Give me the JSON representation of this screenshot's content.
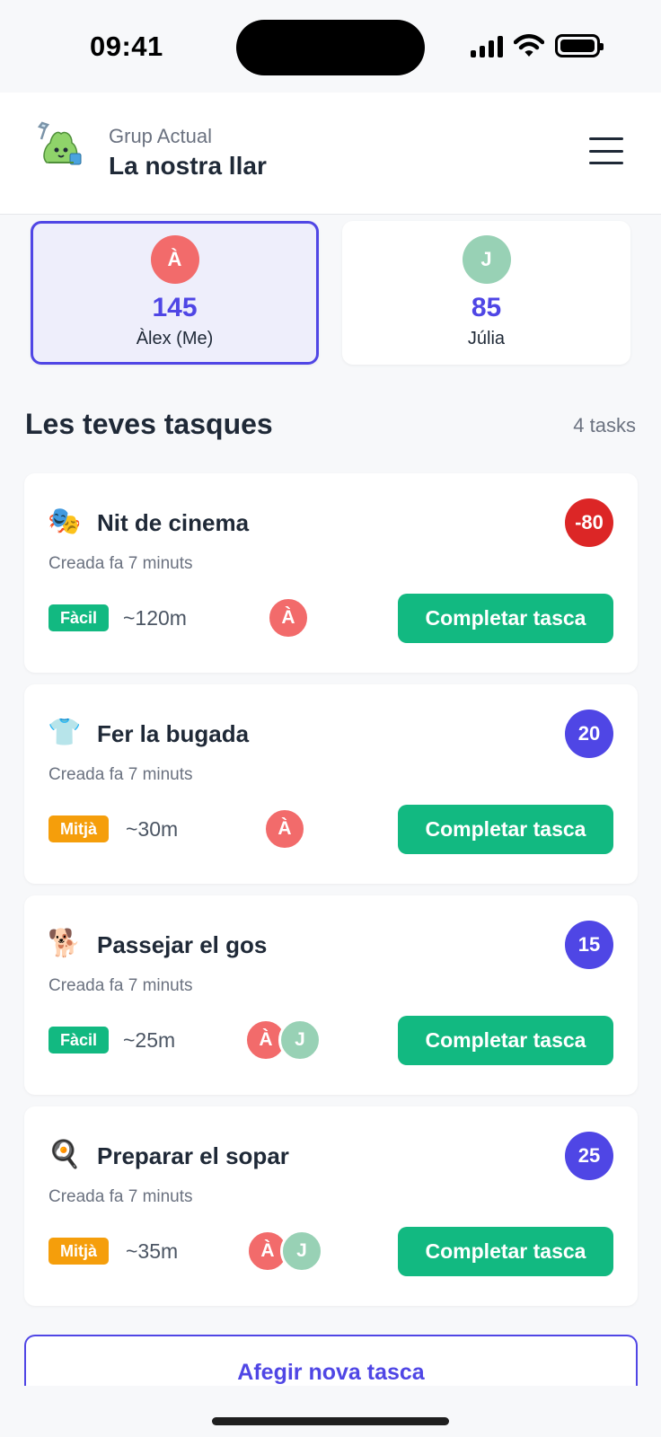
{
  "status_bar": {
    "time": "09:41"
  },
  "header": {
    "caption": "Grup Actual",
    "group_name": "La nostra llar"
  },
  "members": [
    {
      "initial": "À",
      "points": "145",
      "name": "Àlex (Me)",
      "color": "#f26b6b",
      "active": true
    },
    {
      "initial": "J",
      "points": "85",
      "name": "Júlia",
      "color": "#98d1b5",
      "active": false
    }
  ],
  "section": {
    "title": "Les teves tasques",
    "count": "4 tasks"
  },
  "tasks": [
    {
      "emoji": "🎭",
      "title": "Nit de cinema",
      "created": "Creada fa 7 minuts",
      "points": "-80",
      "points_color": "#dc2626",
      "difficulty": "Fàcil",
      "difficulty_color": "#12b981",
      "duration": "~120m",
      "assignees": [
        "À"
      ],
      "button": "Completar tasca"
    },
    {
      "emoji": "👕",
      "title": "Fer la bugada",
      "created": "Creada fa 7 minuts",
      "points": "20",
      "points_color": "#4f46e5",
      "difficulty": "Mitjà",
      "difficulty_color": "#f59e0b",
      "duration": "~30m",
      "assignees": [
        "À"
      ],
      "button": "Completar tasca"
    },
    {
      "emoji": "🐕",
      "title": "Passejar el gos",
      "created": "Creada fa 7 minuts",
      "points": "15",
      "points_color": "#4f46e5",
      "difficulty": "Fàcil",
      "difficulty_color": "#12b981",
      "duration": "~25m",
      "assignees": [
        "À",
        "J"
      ],
      "button": "Completar tasca"
    },
    {
      "emoji": "🍳",
      "title": "Preparar el sopar",
      "created": "Creada fa 7 minuts",
      "points": "25",
      "points_color": "#4f46e5",
      "difficulty": "Mitjà",
      "difficulty_color": "#f59e0b",
      "duration": "~35m",
      "assignees": [
        "À",
        "J"
      ],
      "button": "Completar tasca"
    }
  ],
  "add_task_label": "Afegir nova tasca",
  "icons": {
    "logo": "green-blob-mascot-icon",
    "menu": "hamburger-menu-icon",
    "signal": "cellular-signal-icon",
    "wifi": "wifi-icon",
    "battery": "battery-icon"
  }
}
